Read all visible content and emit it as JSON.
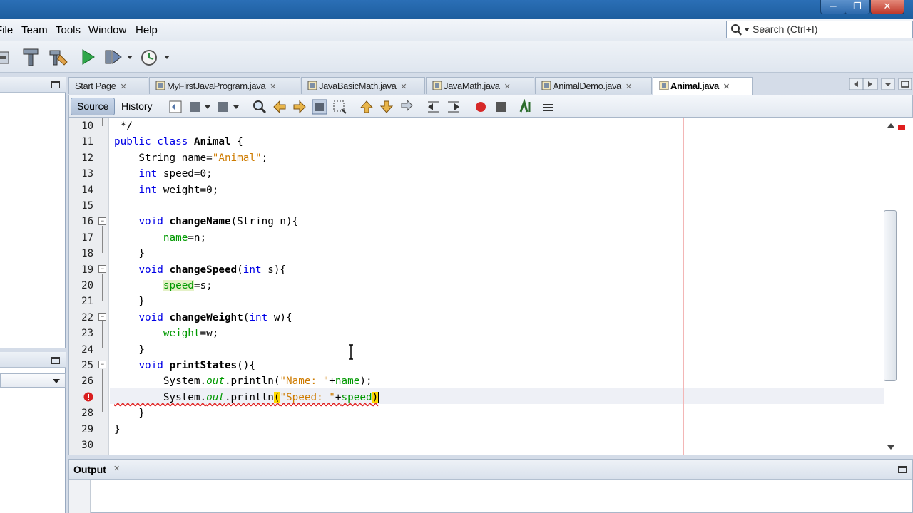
{
  "menu": [
    "File",
    "Team",
    "Tools",
    "Window",
    "Help"
  ],
  "search": {
    "placeholder": "Search (Ctrl+I)"
  },
  "tabs": [
    {
      "label": "Start Page"
    },
    {
      "label": "MyFirstJavaProgram.java"
    },
    {
      "label": "JavaBasicMath.java"
    },
    {
      "label": "JavaMath.java"
    },
    {
      "label": "AnimalDemo.java"
    },
    {
      "label": "Animal.java",
      "active": true
    }
  ],
  "editor_toolbar": {
    "source_label": "Source",
    "history_label": "History"
  },
  "output": {
    "title": "Output"
  },
  "code": {
    "lines": [
      {
        "n": "10",
        "text": " */"
      },
      {
        "n": "11",
        "text": "public class Animal {"
      },
      {
        "n": "12",
        "text": "    String name=\"Animal\";"
      },
      {
        "n": "13",
        "text": "    int speed=0;"
      },
      {
        "n": "14",
        "text": "    int weight=0;"
      },
      {
        "n": "15",
        "text": ""
      },
      {
        "n": "16",
        "text": "    void changeName(String n){"
      },
      {
        "n": "17",
        "text": "        name=n;"
      },
      {
        "n": "18",
        "text": "    }"
      },
      {
        "n": "19",
        "text": "    void changeSpeed(int s){"
      },
      {
        "n": "20",
        "text": "        speed=s;"
      },
      {
        "n": "21",
        "text": "    }"
      },
      {
        "n": "22",
        "text": "    void changeWeight(int w){"
      },
      {
        "n": "23",
        "text": "        weight=w;"
      },
      {
        "n": "24",
        "text": "    }"
      },
      {
        "n": "25",
        "text": "    void printStates(){"
      },
      {
        "n": "26",
        "text": "        System.out.println(\"Name: \"+name);"
      },
      {
        "n": "",
        "text": "        System.out.println(\"Speed: \"+speed)"
      },
      {
        "n": "28",
        "text": "    }"
      },
      {
        "n": "29",
        "text": "}"
      },
      {
        "n": "30",
        "text": ""
      }
    ]
  },
  "colors": {
    "keyword": "#0000e6",
    "string": "#ce7b00",
    "field": "#009900",
    "error": "#e02020"
  }
}
